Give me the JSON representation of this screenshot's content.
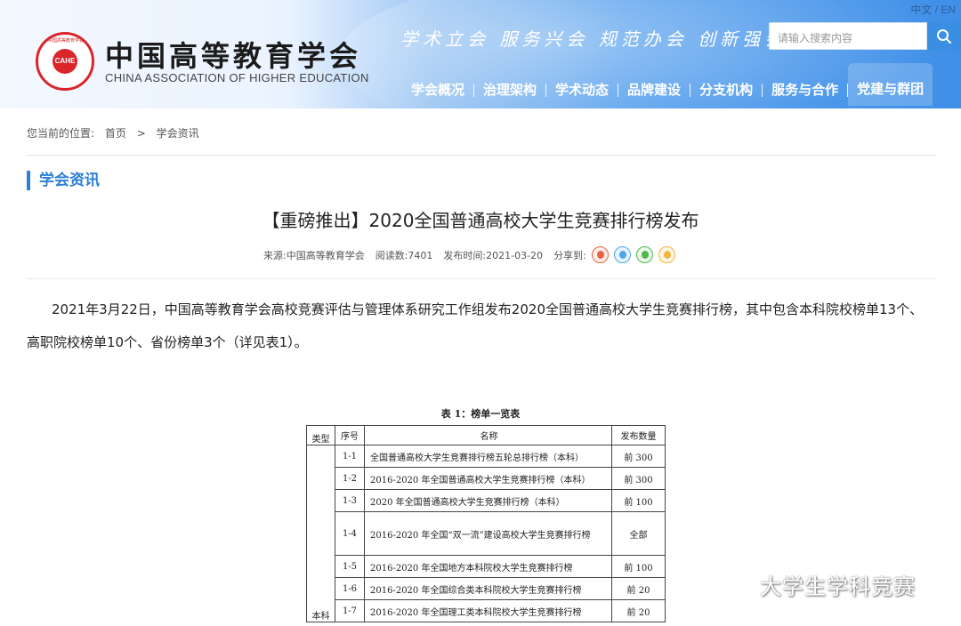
{
  "header": {
    "site_name_cn": "中国高等教育学会",
    "site_name_en": "CHINA ASSOCIATION OF HIGHER EDUCATION",
    "logo_text": "CAHE",
    "logo_ring_text": "中国高等教育学会",
    "slogan": "学术立会  服务兴会  规范办会  创新强会",
    "language_switch": "中文 / EN",
    "search_placeholder": "请输入搜索内容",
    "nav": [
      {
        "label": "学会概况"
      },
      {
        "label": "治理架构"
      },
      {
        "label": "学术动态"
      },
      {
        "label": "品牌建设"
      },
      {
        "label": "分支机构"
      },
      {
        "label": "服务与合作"
      },
      {
        "label": "党建与群团"
      }
    ]
  },
  "breadcrumb": {
    "prefix": "您当前的位置:",
    "home": "首页",
    "separator": ">",
    "current": "学会资讯"
  },
  "section_title": "学会资讯",
  "article": {
    "title": "【重磅推出】2020全国普通高校大学生竞赛排行榜发布",
    "source": "来源:中国高等教育学会",
    "views": "阅读数:7401",
    "published": "发布时间:2021-03-20",
    "share_label": "分享到:",
    "share_icons": [
      "weibo-icon",
      "qq-icon",
      "wechat-icon",
      "qzone-icon"
    ],
    "paragraph": "2021年3月22日，中国高等教育学会高校竞赛评估与管理体系研究工作组发布2020全国普通高校大学生竞赛排行榜，其中包含本科院校榜单13个、高职院校榜单10个、省份榜单3个（详见表1）。"
  },
  "table": {
    "caption": "表 1：榜单一览表",
    "headers": [
      "类型",
      "序号",
      "名称",
      "发布数量"
    ],
    "type_label": "本科",
    "rows": [
      {
        "seq": "1-1",
        "name": "全国普通高校大学生竞赛排行榜五轮总排行榜（本科）",
        "count": "前 300"
      },
      {
        "seq": "1-2",
        "name": "2016-2020 年全国普通高校大学生竞赛排行榜（本科）",
        "count": "前 300"
      },
      {
        "seq": "1-3",
        "name": "2020 年全国普通高校大学生竞赛排行榜（本科）",
        "count": "前 100"
      },
      {
        "seq": "1-4",
        "name": "2016-2020 年全国“双一流”建设高校大学生竞赛排行榜",
        "count": "全部"
      },
      {
        "seq": "1-5",
        "name": "2016-2020 年全国地方本科院校大学生竞赛排行榜",
        "count": "前 100"
      },
      {
        "seq": "1-6",
        "name": "2016-2020 年全国综合类本科院校大学生竞赛排行榜",
        "count": "前 20"
      },
      {
        "seq": "1-7",
        "name": "2016-2020 年全国理工类本科院校大学生竞赛排行榜",
        "count": "前 20"
      }
    ]
  },
  "watermark": "大学生学科竞赛",
  "colors": {
    "accent": "#2c7fd6",
    "header_blue": "#3f8fe8",
    "logo_red": "#d9262b"
  }
}
